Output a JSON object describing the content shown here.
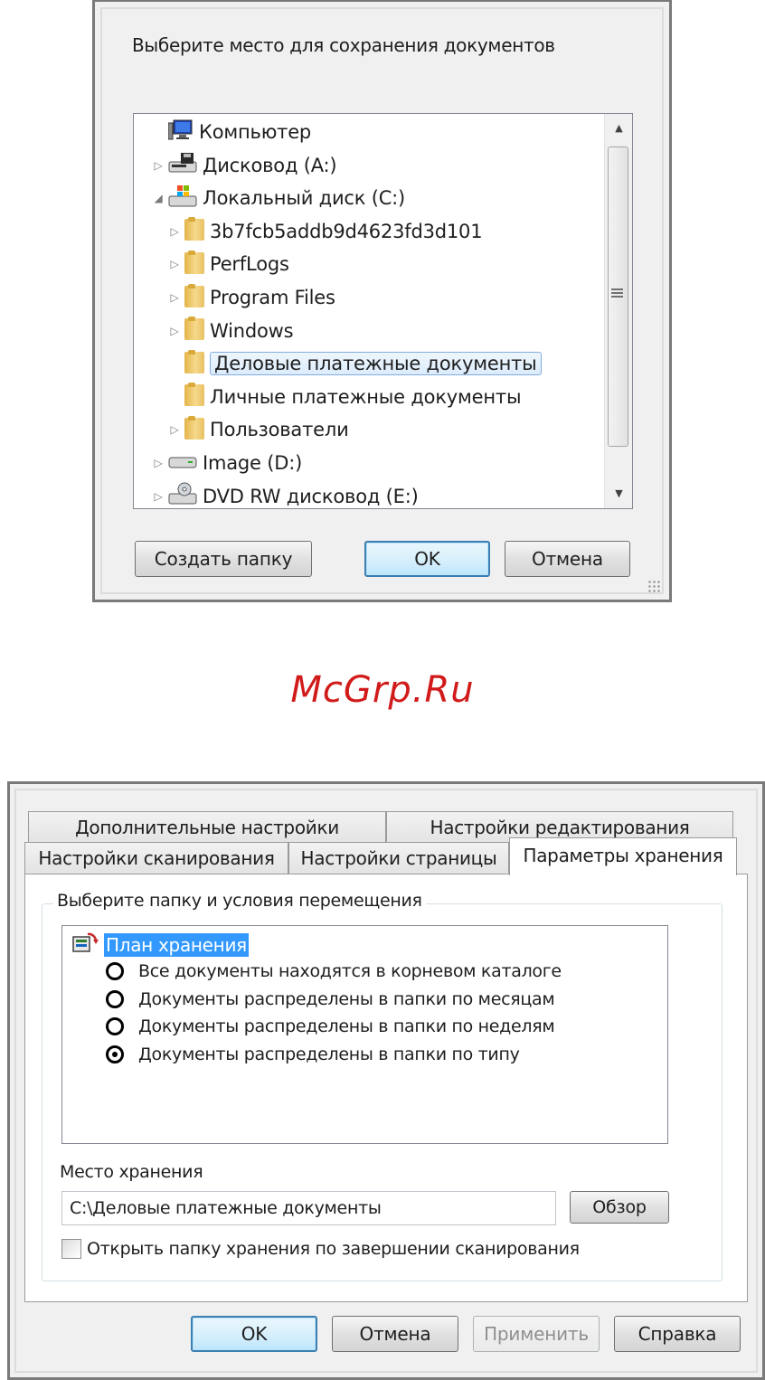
{
  "dialog1": {
    "title": "Выберите место для сохранения документов",
    "tree": [
      {
        "label": "Компьютер",
        "icon": "computer-icon",
        "level": 0,
        "arrow": ""
      },
      {
        "label": "Дисковод (A:)",
        "icon": "floppy-drive-icon",
        "level": 0,
        "arrow": "▷"
      },
      {
        "label": "Локальный диск (C:)",
        "icon": "local-disk-icon",
        "level": 0,
        "arrow": "◢"
      },
      {
        "label": "3b7fcb5addb9d4623fd3d101",
        "icon": "folder-icon",
        "level": 1,
        "arrow": "▷"
      },
      {
        "label": "PerfLogs",
        "icon": "folder-icon",
        "level": 1,
        "arrow": "▷"
      },
      {
        "label": "Program Files",
        "icon": "folder-icon",
        "level": 1,
        "arrow": "▷"
      },
      {
        "label": "Windows",
        "icon": "folder-icon",
        "level": 1,
        "arrow": "▷"
      },
      {
        "label": "Деловые платежные документы",
        "icon": "folder-icon",
        "level": 1,
        "arrow": "",
        "selected": true
      },
      {
        "label": "Личные платежные документы",
        "icon": "folder-icon",
        "level": 1,
        "arrow": ""
      },
      {
        "label": "Пользователи",
        "icon": "folder-icon",
        "level": 1,
        "arrow": "▷"
      },
      {
        "label": "Image (D:)",
        "icon": "drive-icon",
        "level": 0,
        "arrow": "▷"
      },
      {
        "label": "DVD RW дисковод (E:)",
        "icon": "dvd-drive-icon",
        "level": 0,
        "arrow": "▷"
      }
    ],
    "buttons": {
      "new_folder": "Создать папку",
      "ok": "OK",
      "cancel": "Отмена"
    }
  },
  "watermark": "McGrp.Ru",
  "dialog2": {
    "tabs_back": [
      "Дополнительные настройки",
      "Настройки редактирования"
    ],
    "tabs_front": [
      "Настройки сканирования",
      "Настройки страницы",
      "Параметры хранения"
    ],
    "active_tab": "Параметры хранения",
    "group_title": "Выберите папку и условия перемещения",
    "plan_title": "План хранения",
    "options": [
      {
        "label": "Все документы находятся в корневом каталоге",
        "checked": false
      },
      {
        "label": "Документы распределены в папки по месяцам",
        "checked": false
      },
      {
        "label": "Документы распределены в папки по неделям",
        "checked": false
      },
      {
        "label": "Документы распределены в папки по типу",
        "checked": true
      }
    ],
    "location_label": "Место хранения",
    "location_value": "C:\\Деловые платежные документы",
    "browse": "Обзор",
    "open_folder_label": "Открыть папку хранения по завершении сканирования",
    "open_folder_checked": false,
    "buttons": {
      "ok": "OK",
      "cancel": "Отмена",
      "apply": "Применить",
      "help": "Справка"
    }
  }
}
